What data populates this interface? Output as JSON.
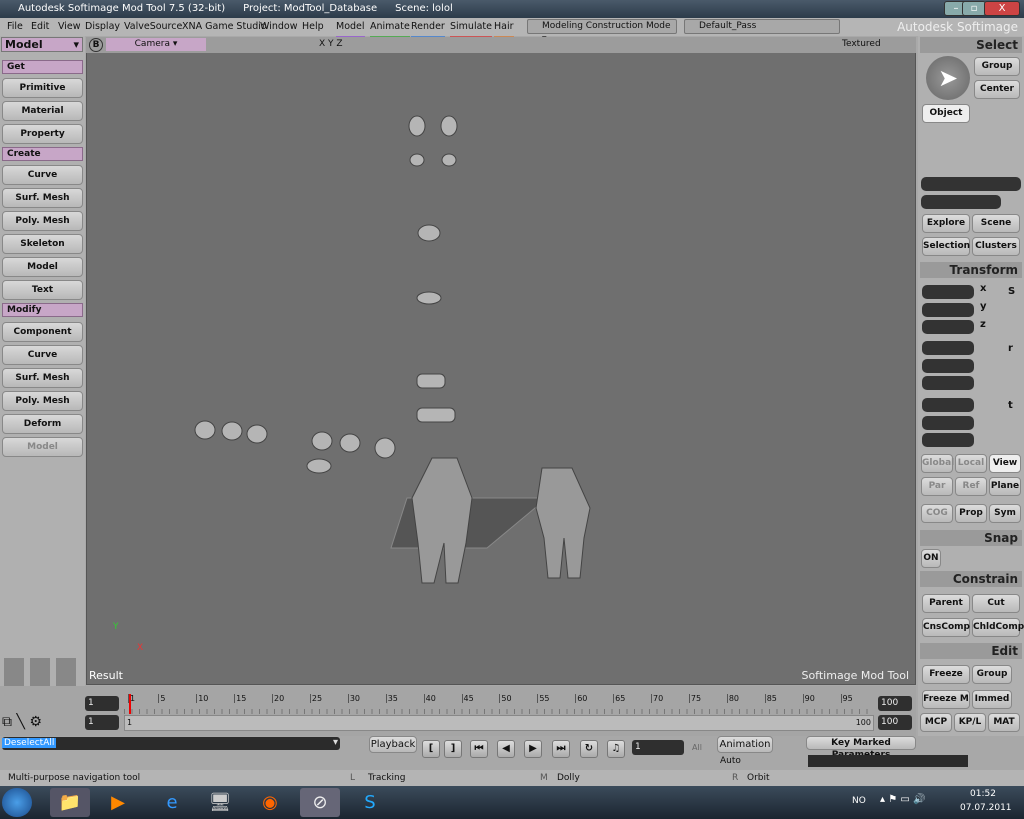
{
  "titlebar": {
    "app": "Autodesk Softimage Mod Tool 7.5 (32-bit)",
    "project": "Project: ModTool_Database",
    "scene": "Scene: lolol"
  },
  "menu": [
    "File",
    "Edit",
    "View",
    "Display",
    "ValveSource",
    "XNA Game Studio",
    "Window",
    "Help",
    "Model",
    "Animate",
    "Render",
    "Simulate",
    "Hair"
  ],
  "mode_select": "Modeling Construction Mode",
  "pass_select": "Default_Pass",
  "brand": "Autodesk Softimage",
  "left": {
    "module": "Model",
    "sections": [
      {
        "title": "Get",
        "items": [
          "Primitive",
          "Material",
          "Property"
        ]
      },
      {
        "title": "Create",
        "items": [
          "Curve",
          "Surf. Mesh",
          "Poly. Mesh",
          "Skeleton",
          "Model",
          "Text"
        ]
      },
      {
        "title": "Modify",
        "items": [
          "Component",
          "Curve",
          "Surf. Mesh",
          "Poly. Mesh",
          "Deform",
          "Model"
        ]
      }
    ]
  },
  "viewport": {
    "letter": "B",
    "camera": "Camera",
    "axes": "X Y Z",
    "display": "Textured",
    "result": "Result",
    "watermark": "Softimage Mod Tool",
    "axis_x": "X",
    "axis_y": "Y"
  },
  "right": {
    "select": "Select",
    "group": "Group",
    "center": "Center",
    "object": "Object",
    "explore": "Explore",
    "scene": "Scene",
    "selection": "Selection",
    "clusters": "Clusters",
    "transform": "Transform",
    "x": "x",
    "y": "y",
    "z": "z",
    "s": "S",
    "r": "r",
    "t": "t",
    "global": "Global",
    "local": "Local",
    "view": "View",
    "par": "Par",
    "ref": "Ref",
    "plane": "Plane",
    "cog": "COG",
    "prop": "Prop",
    "sym": "Sym",
    "snap": "Snap",
    "on": "ON",
    "constrain": "Constrain",
    "parent": "Parent",
    "cut": "Cut",
    "cnscomp": "CnsComp",
    "chldcomp": "ChldComp",
    "edit": "Edit",
    "freeze": "Freeze",
    "group2": "Group",
    "freezem": "Freeze M",
    "immed": "Immed",
    "tabs": [
      "MCP",
      "KP/L",
      "MAT"
    ]
  },
  "timeline": {
    "start": "1",
    "end": "100",
    "range_start": "1",
    "range_end": "100",
    "range_left": "1",
    "range_right": "100",
    "ticks": [
      "1",
      "5",
      "10",
      "15",
      "20",
      "25",
      "30",
      "35",
      "40",
      "45",
      "50",
      "55",
      "60",
      "65",
      "70",
      "75",
      "80",
      "85",
      "90",
      "95"
    ]
  },
  "bottom": {
    "command": "DeselectAll",
    "playback": "Playback",
    "frame": "1",
    "all": "All",
    "animation": "Animation",
    "auto": "Auto",
    "key_marked": "Key Marked Parameters"
  },
  "status": {
    "hint": "Multi-purpose navigation tool",
    "l": "L",
    "l_text": "Tracking",
    "m": "M",
    "m_text": "Dolly",
    "r": "R",
    "r_text": "Orbit"
  },
  "taskbar": {
    "lang": "NO",
    "time": "01:52",
    "date": "07.07.2011"
  }
}
